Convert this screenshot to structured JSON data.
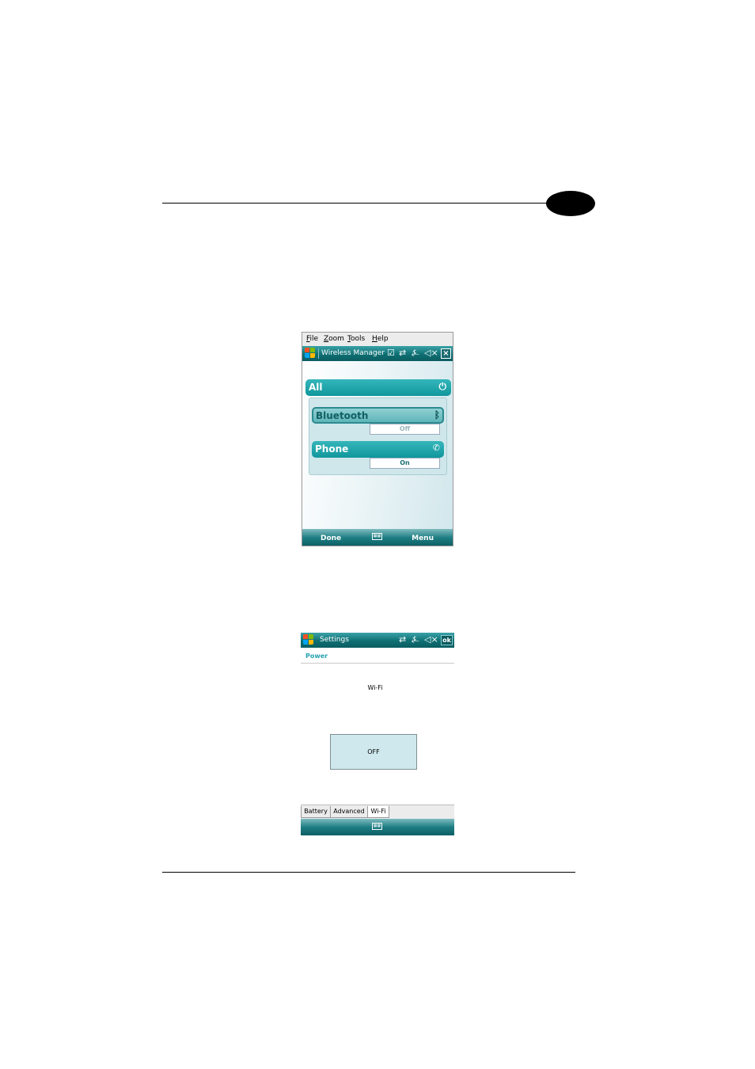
{
  "colors": {
    "title_bar": "#0f6f73",
    "pill_teal": "#1fa6ab",
    "power_header": "#27a2b0",
    "off_button_bg": "#cfe8ed"
  },
  "wireless_manager": {
    "menu": [
      {
        "label": "File"
      },
      {
        "label": "Zoom"
      },
      {
        "label": "Tools"
      },
      {
        "label": "Help"
      }
    ],
    "title": "Wireless Manager",
    "title_icons": [
      "checkbox-icon",
      "connectivity-icon",
      "signal-off-icon",
      "speaker-mute-icon",
      "close-icon"
    ],
    "all": {
      "label": "All",
      "icon": "power-icon"
    },
    "bluetooth": {
      "label": "Bluetooth",
      "status": "Off",
      "icon": "bluetooth-off-icon"
    },
    "phone": {
      "label": "Phone",
      "status": "On",
      "icon": "phone-icon"
    },
    "softkeys": {
      "left": "Done",
      "right": "Menu",
      "center_icon": "keyboard-icon"
    }
  },
  "settings": {
    "title": "Settings",
    "title_icons": [
      "connectivity-icon",
      "signal-off-icon",
      "speaker-mute-icon"
    ],
    "ok": "ok",
    "section": "Power",
    "wifi_label": "Wi-Fi",
    "wifi_button": "OFF",
    "tabs": [
      {
        "label": "Battery",
        "active": false
      },
      {
        "label": "Advanced",
        "active": false
      },
      {
        "label": "Wi-Fi",
        "active": true
      }
    ],
    "center_icon": "keyboard-icon"
  }
}
